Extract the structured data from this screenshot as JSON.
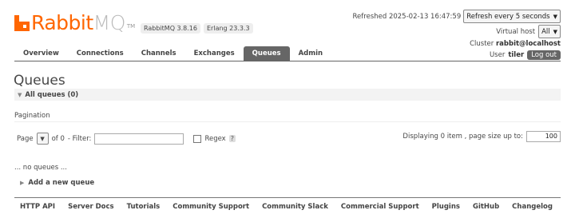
{
  "logo": {
    "text_main": "Rabbit",
    "text_mq": "MQ",
    "tm": "TM"
  },
  "versions": {
    "rabbitmq": "RabbitMQ 3.8.16",
    "erlang": "Erlang 23.3.3"
  },
  "header": {
    "refreshed_label": "Refreshed 2025-02-13 16:47:59",
    "refresh_select": "Refresh every 5 seconds",
    "vhost_label": "Virtual host",
    "vhost_value": "All",
    "cluster_label": "Cluster",
    "cluster_value": "rabbit@localhost",
    "user_label": "User",
    "user_value": "tiler",
    "logout_label": "Log out"
  },
  "nav": {
    "items": [
      "Overview",
      "Connections",
      "Channels",
      "Exchanges",
      "Queues",
      "Admin"
    ],
    "active": "Queues"
  },
  "main": {
    "title": "Queues",
    "section_title": "All queues (0)",
    "pagination_label": "Pagination",
    "page_label": "Page",
    "of_label": "of 0",
    "filter_label": "- Filter:",
    "regex_label": "Regex",
    "help_label": "?",
    "displaying_label": "Displaying 0 item , page size up to:",
    "page_size": "100",
    "empty_text": "... no queues ...",
    "add_queue_label": "Add a new queue"
  },
  "footer": {
    "links": [
      "HTTP API",
      "Server Docs",
      "Tutorials",
      "Community Support",
      "Community Slack",
      "Commercial Support",
      "Plugins",
      "GitHub",
      "Changelog"
    ]
  },
  "colors": {
    "brand": "#ff6600",
    "nav_active": "#666666"
  }
}
